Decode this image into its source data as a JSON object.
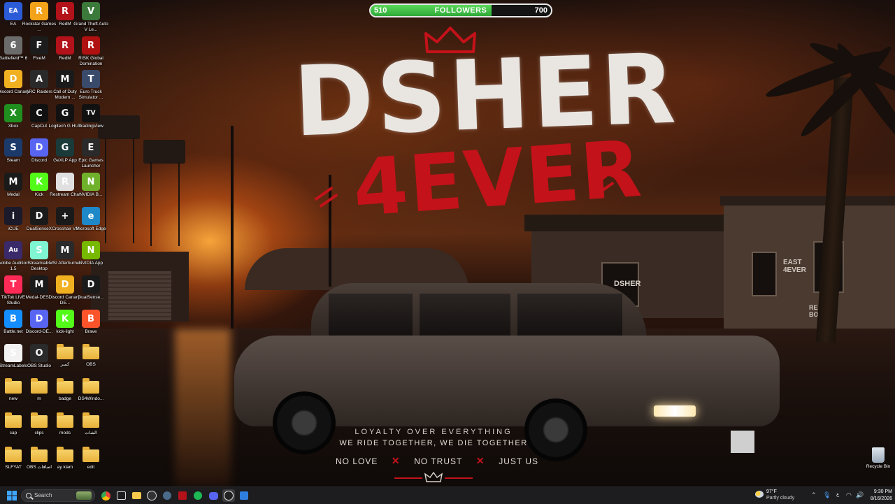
{
  "wallpaper": {
    "title_line1": "DSHER",
    "title_line2": "4EVER",
    "tagline": "LOYALTY OVER EVERYTHING",
    "tagline2": "WE RIDE TOGETHER, WE DIE TOGETHER",
    "motto": [
      "NO LOVE",
      "NO TRUST",
      "JUST US"
    ],
    "wall_graffiti": [
      "DSHER",
      "EAST 4EVER",
      "REAL BOYS"
    ],
    "colors": {
      "white_paint": "#e9e6e2",
      "red_paint": "#c4121a"
    }
  },
  "followers": {
    "current": "510",
    "label": "FOLLOWERS",
    "goal": "700",
    "progress_fraction": 0.67,
    "bar_color": "#3fc24a"
  },
  "desktop_icons": [
    {
      "label": "EA",
      "icon": "ea-icon",
      "glyph": "EA",
      "color": "#2b5bd7"
    },
    {
      "label": "Rockstar Games ...",
      "icon": "rockstar-icon",
      "glyph": "R",
      "color": "#f2a31a"
    },
    {
      "label": "RedM",
      "icon": "redm-icon",
      "glyph": "R",
      "color": "#b3121a"
    },
    {
      "label": "Grand Theft Auto V Le...",
      "icon": "gta-icon",
      "glyph": "V",
      "color": "#3b7a3a"
    },
    {
      "label": "Battlefield™ 6",
      "icon": "battlefield-icon",
      "glyph": "6",
      "color": "#6b6b6b"
    },
    {
      "label": "FiveM",
      "icon": "fivem-icon",
      "glyph": "F",
      "color": "#1c1c1c"
    },
    {
      "label": "RedM",
      "icon": "redm-icon",
      "glyph": "R",
      "color": "#b3121a"
    },
    {
      "label": "RISK Global Domination",
      "icon": "risk-icon",
      "glyph": "R",
      "color": "#b01010"
    },
    {
      "label": "Discord Canary",
      "icon": "discord-canary-icon",
      "glyph": "D",
      "color": "#f0b020"
    },
    {
      "label": "ARC Raiders",
      "icon": "arc-raiders-icon",
      "glyph": "A",
      "color": "#2a2a2a"
    },
    {
      "label": "Call of Duty Modern ...",
      "icon": "cod-icon",
      "glyph": "M",
      "color": "#1a1a1a"
    },
    {
      "label": "Euro Truck Simulator ...",
      "icon": "euro-truck-icon",
      "glyph": "T",
      "color": "#3a4a6a"
    },
    {
      "label": "Xbox",
      "icon": "xbox-icon",
      "glyph": "X",
      "color": "#1f8f1f"
    },
    {
      "label": "CapCut",
      "icon": "capcut-icon",
      "glyph": "C",
      "color": "#111111"
    },
    {
      "label": "Logitech G HUB",
      "icon": "logitech-icon",
      "glyph": "G",
      "color": "#111111"
    },
    {
      "label": "TradingView",
      "icon": "tradingview-icon",
      "glyph": "TV",
      "color": "#111111"
    },
    {
      "label": "Steam",
      "icon": "steam-icon",
      "glyph": "S",
      "color": "#1b3a6a"
    },
    {
      "label": "Discord",
      "icon": "discord-icon",
      "glyph": "D",
      "color": "#5865f2"
    },
    {
      "label": "GeXLP App",
      "icon": "gexlp-icon",
      "glyph": "G",
      "color": "#1a3a3a"
    },
    {
      "label": "Epic Games Launcher",
      "icon": "epic-icon",
      "glyph": "E",
      "color": "#2a2a2a"
    },
    {
      "label": "Medal",
      "icon": "medal-icon",
      "glyph": "M",
      "color": "#1a1a1a"
    },
    {
      "label": "Kick",
      "icon": "kick-icon",
      "glyph": "K",
      "color": "#53fc18"
    },
    {
      "label": "Restream Chat",
      "icon": "restream-icon",
      "glyph": "R",
      "color": "#e0e0e0"
    },
    {
      "label": "NVIDIA B...",
      "icon": "nvidia-icon",
      "glyph": "N",
      "color": "#6fb12a"
    },
    {
      "label": "iCUE",
      "icon": "icue-icon",
      "glyph": "i",
      "color": "#1a1a2a"
    },
    {
      "label": "DualSenseX",
      "icon": "dualsense-icon",
      "glyph": "D",
      "color": "#1a1a1a"
    },
    {
      "label": "Crosshair V2",
      "icon": "crosshair-icon",
      "glyph": "+",
      "color": "#1a1a1a"
    },
    {
      "label": "Microsoft Edge",
      "icon": "edge-icon",
      "glyph": "e",
      "color": "#1e88c8"
    },
    {
      "label": "Adobe Audition 1.5",
      "icon": "audition-icon",
      "glyph": "Au",
      "color": "#3a2a6a"
    },
    {
      "label": "Streamlabs Desktop",
      "icon": "streamlabs-icon",
      "glyph": "S",
      "color": "#80f5d2"
    },
    {
      "label": "MSI Afterburner",
      "icon": "msi-icon",
      "glyph": "M",
      "color": "#2a2a2a"
    },
    {
      "label": "NVIDIA App",
      "icon": "nvidia-app-icon",
      "glyph": "N",
      "color": "#76b900"
    },
    {
      "label": "TikTok LIVE Studio",
      "icon": "tiktok-icon",
      "glyph": "T",
      "color": "#ff2a55"
    },
    {
      "label": "Medal-DES...",
      "icon": "medal-icon",
      "glyph": "M",
      "color": "#1a1a1a"
    },
    {
      "label": "Discord Canary-DE...",
      "icon": "discord-canary-icon",
      "glyph": "D",
      "color": "#f0b020"
    },
    {
      "label": "DualSense...",
      "icon": "dualsense-icon",
      "glyph": "D",
      "color": "#1a1a1a"
    },
    {
      "label": "Battle.net",
      "icon": "battlenet-icon",
      "glyph": "B",
      "color": "#148eff"
    },
    {
      "label": "Discord-DE...",
      "icon": "discord-icon",
      "glyph": "D",
      "color": "#5865f2"
    },
    {
      "label": "kick-light",
      "icon": "kick-icon",
      "glyph": "K",
      "color": "#53fc18"
    },
    {
      "label": "Brave",
      "icon": "brave-icon",
      "glyph": "B",
      "color": "#fb542b"
    },
    {
      "label": "StreamLabels",
      "icon": "streamlabels-icon",
      "glyph": "S",
      "color": "#f2f2f2"
    },
    {
      "label": "OBS Studio",
      "icon": "obs-icon",
      "glyph": "O",
      "color": "#2a2a2a"
    },
    {
      "label": "كسر",
      "icon": "folder-icon",
      "folder": true
    },
    {
      "label": "OBS",
      "icon": "folder-icon",
      "folder": true
    },
    {
      "label": "new",
      "icon": "folder-icon",
      "folder": true
    },
    {
      "label": "m",
      "icon": "folder-icon",
      "folder": true
    },
    {
      "label": "badge",
      "icon": "folder-icon",
      "folder": true
    },
    {
      "label": "DS4Windo...",
      "icon": "folder-icon",
      "folder": true
    },
    {
      "label": "cap",
      "icon": "folder-icon",
      "folder": true
    },
    {
      "label": "clips",
      "icon": "folder-icon",
      "folder": true
    },
    {
      "label": "mods",
      "icon": "folder-icon",
      "folder": true
    },
    {
      "label": "الشات",
      "icon": "folder-icon",
      "folder": true
    },
    {
      "label": "SLFYAT",
      "icon": "folder-icon",
      "folder": true
    },
    {
      "label": "OBS اضافات",
      "icon": "folder-icon",
      "folder": true
    },
    {
      "label": "ay klam",
      "icon": "folder-icon",
      "folder": true
    },
    {
      "label": "edit",
      "icon": "folder-icon",
      "folder": true
    }
  ],
  "recycle_bin": {
    "label": "Recycle Bin"
  },
  "taskbar": {
    "search_placeholder": "Search",
    "apps": [
      "start-icon",
      "chrome-icon",
      "task-view-icon",
      "file-explorer-icon",
      "obs-icon",
      "redm-icon",
      "kick-icon",
      "spotify-icon",
      "discord-icon",
      "obs-icon",
      "streamlabs-icon"
    ],
    "weather_temp": "97°F",
    "weather_desc": "Partly cloudy",
    "time": "9:30 PM",
    "date": "8/16/2026"
  }
}
